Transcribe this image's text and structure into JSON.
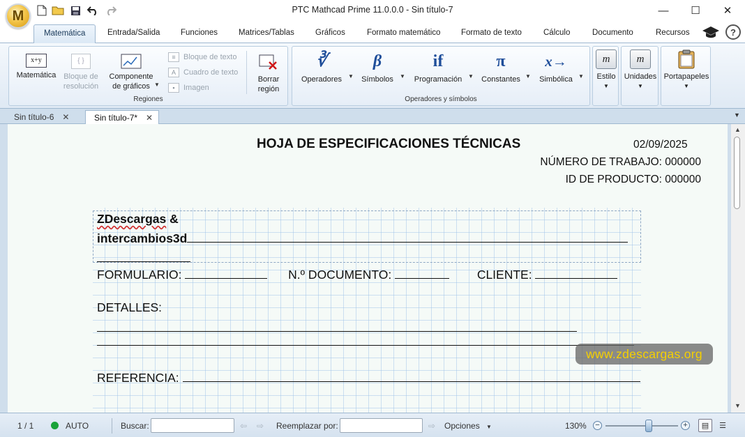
{
  "app": {
    "logo_letter": "M",
    "window_title": "PTC Mathcad Prime 11.0.0.0 - Sin título-7"
  },
  "quick_access": {
    "icons": [
      "new-file-icon",
      "open-folder-icon",
      "save-icon",
      "undo-icon",
      "redo-icon"
    ]
  },
  "window_controls": {
    "minimize": "—",
    "maximize": "☐",
    "close": "✕"
  },
  "ribbon_tabs": {
    "items": [
      {
        "label": "Matemática"
      },
      {
        "label": "Entrada/Salida"
      },
      {
        "label": "Funciones"
      },
      {
        "label": "Matrices/Tablas"
      },
      {
        "label": "Gráficos"
      },
      {
        "label": "Formato matemático"
      },
      {
        "label": "Formato de texto"
      },
      {
        "label": "Cálculo"
      },
      {
        "label": "Documento"
      },
      {
        "label": "Recursos"
      }
    ],
    "active": "Matemática",
    "help": "?"
  },
  "ribbon": {
    "regiones": {
      "label": "Regiones",
      "matematica": "Matemática",
      "matematica_icon_text": "x+y",
      "bloque_resolucion_1": "Bloque de",
      "bloque_resolucion_2": "resolución",
      "componente_1": "Componente",
      "componente_2": "de gráficos",
      "bloque_texto": "Bloque de texto",
      "cuadro_texto": "Cuadro de texto",
      "imagen": "Imagen",
      "borrar_1": "Borrar",
      "borrar_2": "región"
    },
    "operadores": {
      "label": "Operadores y símbolos",
      "operadores": "Operadores",
      "simbolos": "Símbolos",
      "programacion": "Programación",
      "constantes": "Constantes",
      "simbolica": "Simbólica",
      "glyph_operadores": "∛",
      "glyph_simbolos": "β",
      "glyph_programacion": "if",
      "glyph_constantes": "π",
      "glyph_simbolica": "x→"
    },
    "estilo": "Estilo",
    "estilo_glyph": "m",
    "unidades": "Unidades",
    "unidades_glyph": "m",
    "portapapeles": "Portapapeles"
  },
  "doc_tabs": [
    {
      "label": "Sin título-6",
      "close": "✕"
    },
    {
      "label": "Sin título-7*",
      "close": "✕"
    }
  ],
  "worksheet": {
    "title": "HOJA DE ESPECIFICACIONES TÉCNICAS",
    "date": "02/09/2025",
    "numero_trabajo": "NÚMERO DE TRABAJO: 000000",
    "id_producto": "ID DE PRODUCTO:  000000",
    "company_1": "ZDescargas",
    "company_1_amp": " &",
    "company_2": "intercambios3d",
    "formulario": "FORMULARIO:",
    "documento": "N.º DOCUMENTO:",
    "cliente": "CLIENTE:",
    "detalles": "DETALLES:",
    "referencia": "REFERENCIA:",
    "watermark": "www.zdescargas.org"
  },
  "status": {
    "page": "1 / 1",
    "auto": "AUTO",
    "buscar": "Buscar:",
    "reemplazar": "Reemplazar por:",
    "opciones": "Opciones",
    "zoom": "130%",
    "zoom_fraction": 0.6
  }
}
